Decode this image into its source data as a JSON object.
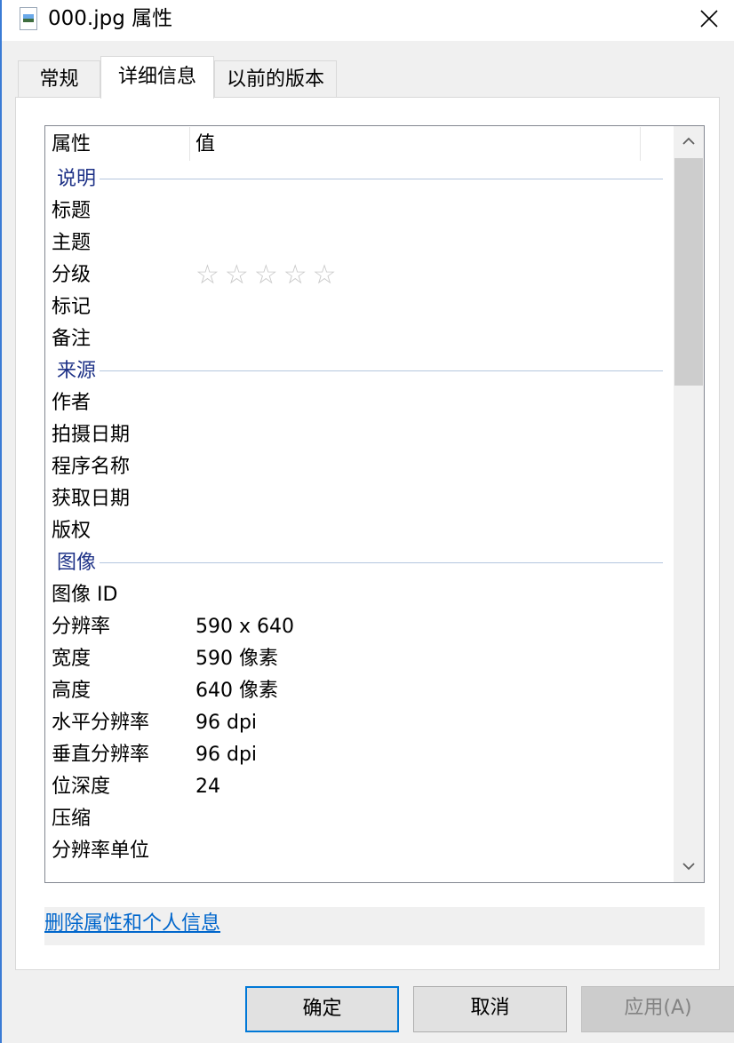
{
  "window": {
    "title": "000.jpg 属性",
    "icon": "image-file-icon",
    "close_icon": "close-icon"
  },
  "tabs": [
    {
      "label": "常规",
      "active": false
    },
    {
      "label": "详细信息",
      "active": true
    },
    {
      "label": "以前的版本",
      "active": false
    }
  ],
  "table": {
    "columns": [
      "属性",
      "值"
    ],
    "groups": {
      "description": {
        "title": "说明",
        "rows": [
          {
            "name": "标题",
            "value": ""
          },
          {
            "name": "主题",
            "value": ""
          },
          {
            "name": "分级",
            "value": ""
          },
          {
            "name": "标记",
            "value": ""
          },
          {
            "name": "备注",
            "value": ""
          }
        ]
      },
      "origin": {
        "title": "来源",
        "rows": [
          {
            "name": "作者",
            "value": ""
          },
          {
            "name": "拍摄日期",
            "value": ""
          },
          {
            "name": "程序名称",
            "value": ""
          },
          {
            "name": "获取日期",
            "value": ""
          },
          {
            "name": "版权",
            "value": ""
          }
        ]
      },
      "image": {
        "title": "图像",
        "rows": [
          {
            "name": "图像 ID",
            "value": ""
          },
          {
            "name": "分辨率",
            "value": "590 x 640"
          },
          {
            "name": "宽度",
            "value": "590 像素"
          },
          {
            "name": "高度",
            "value": "640 像素"
          },
          {
            "name": "水平分辨率",
            "value": "96 dpi"
          },
          {
            "name": "垂直分辨率",
            "value": "96 dpi"
          },
          {
            "name": "位深度",
            "value": "24"
          },
          {
            "name": "压缩",
            "value": ""
          },
          {
            "name": "分辨率单位",
            "value": ""
          }
        ]
      }
    },
    "rating_stars": 0,
    "rating_max": 5,
    "star_glyph": "☆"
  },
  "link": {
    "label": "删除属性和个人信息"
  },
  "buttons": {
    "ok": "确定",
    "cancel": "取消",
    "apply": "应用(A)"
  },
  "colors": {
    "group_title": "#1e3287",
    "link": "#0066cc",
    "default_button_border": "#0078d7"
  }
}
